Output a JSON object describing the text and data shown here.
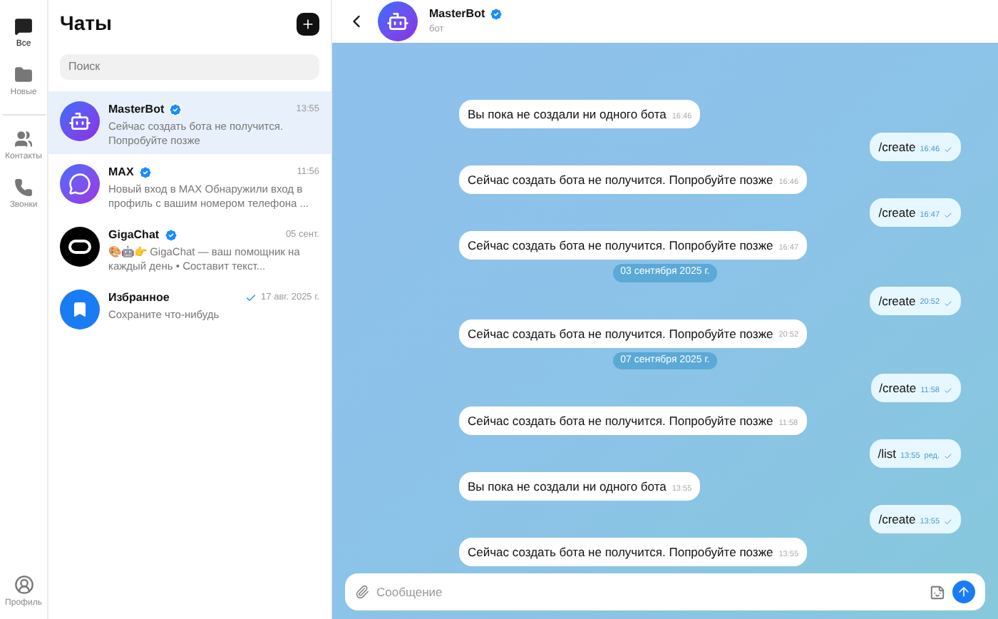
{
  "rail": {
    "items": [
      {
        "label": "Все",
        "selected": true
      },
      {
        "label": "Новые",
        "selected": false
      },
      {
        "label": "Контакты",
        "selected": false
      },
      {
        "label": "Звонки",
        "selected": false
      }
    ],
    "profile": {
      "label": "Профиль"
    }
  },
  "chat_list": {
    "title": "Чаты",
    "search": {
      "placeholder": "Поиск"
    },
    "chats": [
      {
        "name": "MasterBot",
        "verified": true,
        "time": "13:55",
        "preview": "Сейчас создать бота не получится. Попробуйте позже",
        "selected": true,
        "read": false
      },
      {
        "name": "MAX",
        "verified": true,
        "time": "11:56",
        "preview": "Новый вход в MAX Обнаружили вход в профиль с вашим номером телефона ...",
        "selected": false,
        "read": false
      },
      {
        "name": "GigaChat",
        "verified": true,
        "time": "05 сент.",
        "preview": "🎨🤖👉 GigaChat — ваш помощник на каждый день • Составит текст...",
        "selected": false,
        "read": false
      },
      {
        "name": "Избранное",
        "verified": false,
        "time": "17 авг. 2025 г.",
        "preview": "Сохраните что-нибудь",
        "selected": false,
        "read": true
      }
    ]
  },
  "conversation": {
    "header": {
      "name": "MasterBot",
      "verified": true,
      "subtitle": "бот"
    },
    "messages": [
      {
        "kind": "in",
        "text": "Вы пока не создали ни одного бота",
        "time": "16:46"
      },
      {
        "kind": "out",
        "text": "/create",
        "time": "16:46"
      },
      {
        "kind": "in",
        "text": "Сейчас создать бота не получится. Попробуйте позже",
        "time": "16:46"
      },
      {
        "kind": "out",
        "text": "/create",
        "time": "16:47"
      },
      {
        "kind": "in",
        "text": "Сейчас создать бота не получится. Попробуйте позже",
        "time": "16:47"
      },
      {
        "kind": "date",
        "text": "03 сентября 2025 г."
      },
      {
        "kind": "out",
        "text": "/create",
        "time": "20:52"
      },
      {
        "kind": "in",
        "text": "Сейчас создать бота не получится. Попробуйте позже",
        "time": "20:52"
      },
      {
        "kind": "date",
        "text": "07 сентября 2025 г."
      },
      {
        "kind": "out",
        "text": "/create",
        "time": "11:58"
      },
      {
        "kind": "in",
        "text": "Сейчас создать бота не получится. Попробуйте позже",
        "time": "11:58"
      },
      {
        "kind": "out",
        "text": "/list",
        "time": "13:55",
        "edited": "ред."
      },
      {
        "kind": "in",
        "text": "Вы пока не создали ни одного бота",
        "time": "13:55"
      },
      {
        "kind": "out",
        "text": "/create",
        "time": "13:55"
      },
      {
        "kind": "in",
        "text": "Сейчас создать бота не получится. Попробуйте позже",
        "time": "13:55"
      }
    ],
    "composer": {
      "placeholder": "Сообщение"
    }
  }
}
